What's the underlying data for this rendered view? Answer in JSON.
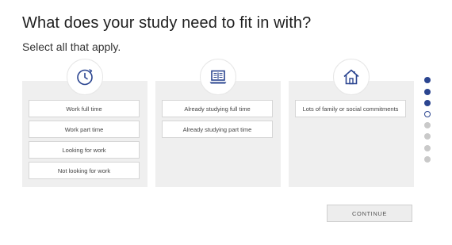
{
  "question": {
    "title": "What does your study need to fit in with?",
    "instruction": "Select all that apply."
  },
  "cards": [
    {
      "icon": "clock-icon",
      "options": [
        "Work full time",
        "Work part time",
        "Looking for work",
        "Not looking for work"
      ]
    },
    {
      "icon": "laptop-icon",
      "options": [
        "Already studying full time",
        "Already studying part time"
      ]
    },
    {
      "icon": "house-icon",
      "options": [
        "Lots of family or social commitments"
      ]
    }
  ],
  "progress": {
    "total_steps": 8,
    "current_step": 4,
    "completed_steps": 3
  },
  "footer": {
    "continue_label": "CONTINUE"
  },
  "colors": {
    "accent": "#2b4590",
    "card_bg": "#efefef",
    "inactive_dot": "#c9c9c9"
  }
}
